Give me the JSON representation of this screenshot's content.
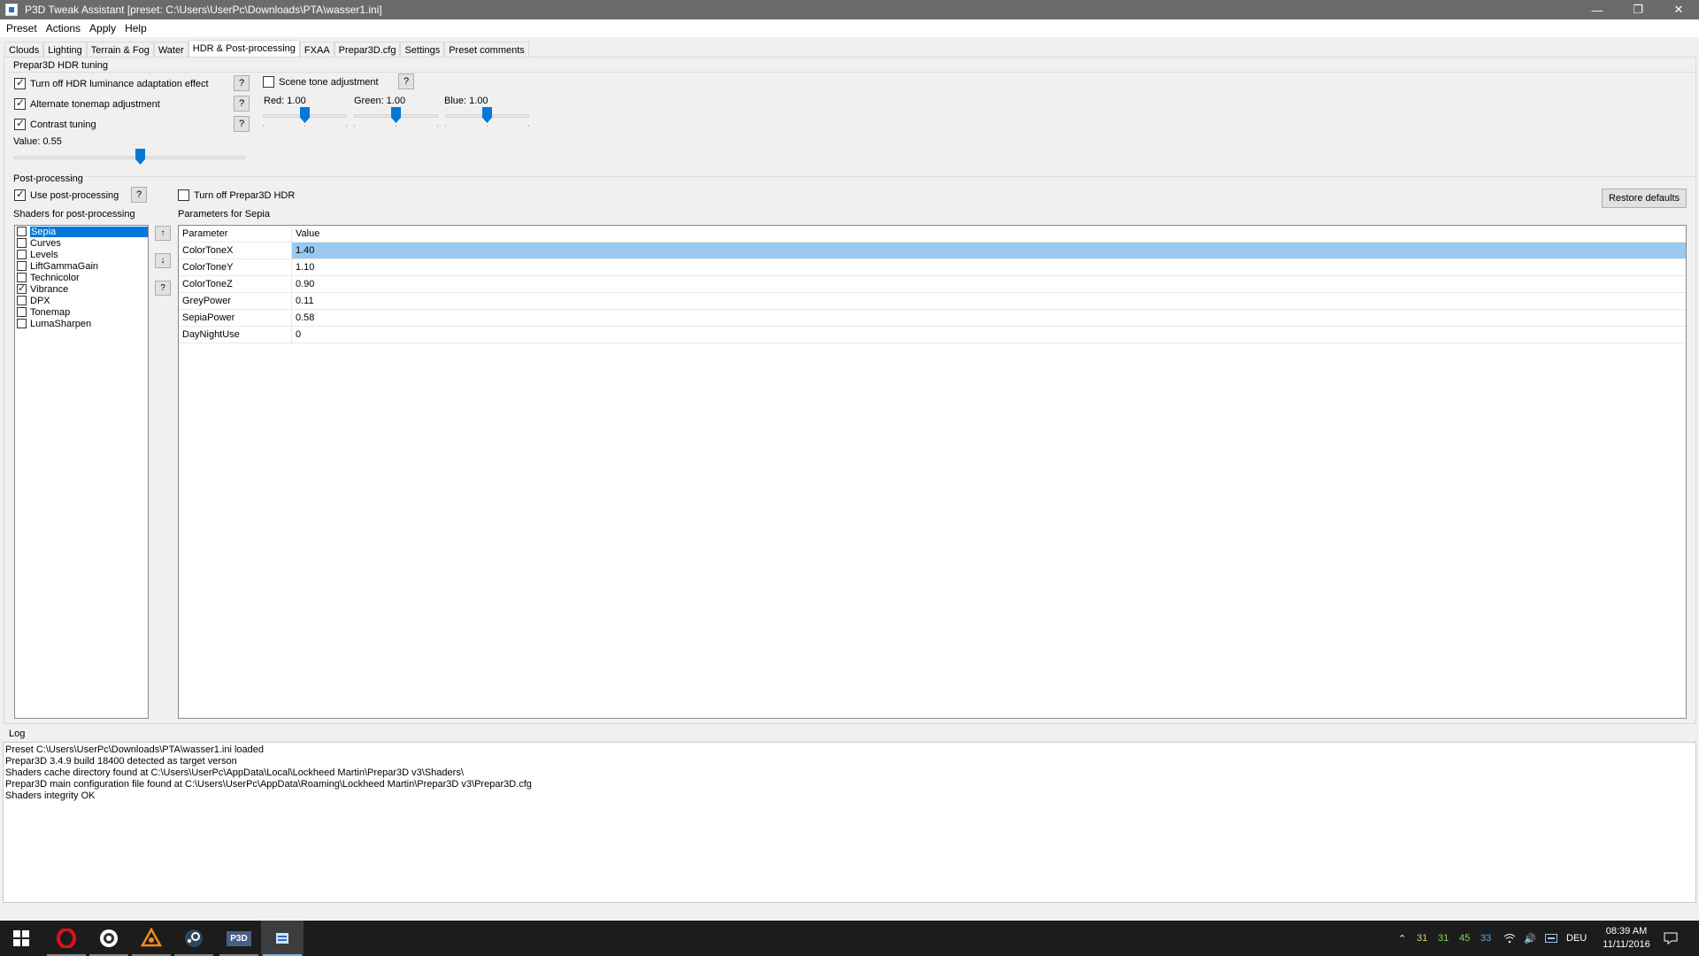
{
  "window": {
    "title": "P3D Tweak Assistant [preset: C:\\Users\\UserPc\\Downloads\\PTA\\wasser1.ini]"
  },
  "menu": [
    "Preset",
    "Actions",
    "Apply",
    "Help"
  ],
  "tabs": [
    "Clouds",
    "Lighting",
    "Terrain & Fog",
    "Water",
    "HDR & Post-processing",
    "FXAA",
    "Prepar3D.cfg",
    "Settings",
    "Preset comments"
  ],
  "active_tab": "HDR & Post-processing",
  "hdr": {
    "group_label": "Prepar3D HDR tuning",
    "luminance_label": "Turn off HDR luminance adaptation effect",
    "luminance_checked": true,
    "tonemap_label": "Alternate tonemap adjustment",
    "tonemap_checked": true,
    "contrast_label": "Contrast tuning",
    "contrast_checked": true,
    "value_label": "Value: 0.55",
    "contrast_slider": 0.55,
    "scene_tone_label": "Scene tone adjustment",
    "scene_tone_checked": false,
    "red_label": "Red: 1.00",
    "green_label": "Green: 1.00",
    "blue_label": "Blue: 1.00",
    "help": "?"
  },
  "post": {
    "group_label": "Post-processing",
    "use_label": "Use post-processing",
    "use_checked": true,
    "turn_off_hdr_label": "Turn off Prepar3D HDR",
    "turn_off_hdr_checked": false,
    "restore_label": "Restore defaults",
    "shaders_label": "Shaders for post-processing",
    "params_label": "Parameters for Sepia",
    "up_label": "↑",
    "down_label": "↓",
    "help": "?",
    "shaders": [
      {
        "name": "Sepia",
        "checked": false,
        "selected": true
      },
      {
        "name": "Curves",
        "checked": false
      },
      {
        "name": "Levels",
        "checked": false
      },
      {
        "name": "LiftGammaGain",
        "checked": false
      },
      {
        "name": "Technicolor",
        "checked": false
      },
      {
        "name": "Vibrance",
        "checked": true
      },
      {
        "name": "DPX",
        "checked": false
      },
      {
        "name": "Tonemap",
        "checked": false
      },
      {
        "name": "LumaSharpen",
        "checked": false
      }
    ],
    "grid_headers": [
      "Parameter",
      "Value"
    ],
    "params": [
      {
        "name": "ColorToneX",
        "value": "1.40",
        "selected": true
      },
      {
        "name": "ColorToneY",
        "value": "1.10"
      },
      {
        "name": "ColorToneZ",
        "value": "0.90"
      },
      {
        "name": "GreyPower",
        "value": "0.11"
      },
      {
        "name": "SepiaPower",
        "value": "0.58"
      },
      {
        "name": "DayNightUse",
        "value": "0"
      }
    ]
  },
  "log": {
    "label": "Log",
    "lines": [
      "Preset C:\\Users\\UserPc\\Downloads\\PTA\\wasser1.ini loaded",
      "Prepar3D 3.4.9 build 18400 detected as target verson",
      "Shaders cache directory found at C:\\Users\\UserPc\\AppData\\Local\\Lockheed Martin\\Prepar3D v3\\Shaders\\",
      "Prepar3D main configuration file found at C:\\Users\\UserPc\\AppData\\Roaming\\Lockheed Martin\\Prepar3D v3\\Prepar3D.cfg",
      "Shaders integrity OK"
    ]
  },
  "taskbar": {
    "p3d_label": "P3D",
    "tray_numbers": [
      "31",
      "31",
      "45",
      "33"
    ],
    "tray_colors": [
      "#e8d24a",
      "#7ed957",
      "#7ed957",
      "#5aa9e6"
    ],
    "language": "DEU",
    "time": "08:39 AM",
    "date": "11/11/2016"
  }
}
